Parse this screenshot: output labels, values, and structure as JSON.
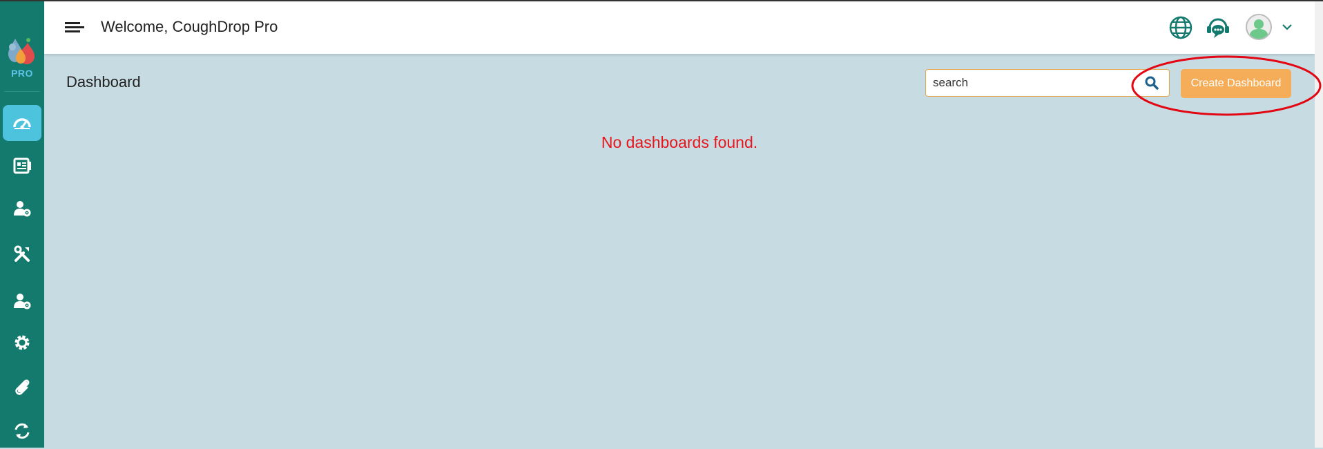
{
  "brand": {
    "badge": "PRO"
  },
  "header": {
    "welcome": "Welcome, CoughDrop Pro"
  },
  "sidebar": {
    "items": [
      {
        "icon": "dashboard-gauge-icon",
        "active": true
      },
      {
        "icon": "boards-icon",
        "active": false
      },
      {
        "icon": "user-settings-icon",
        "active": false
      },
      {
        "icon": "tools-icon",
        "active": false
      },
      {
        "icon": "user-settings-icon",
        "active": false
      },
      {
        "icon": "gear-icon",
        "active": false
      },
      {
        "icon": "paperclip-icon",
        "active": false
      },
      {
        "icon": "sync-icon",
        "active": false
      }
    ]
  },
  "main": {
    "title": "Dashboard",
    "search": {
      "placeholder": "search"
    },
    "create_label": "Create Dashboard",
    "empty_message": "No dashboards found."
  },
  "colors": {
    "sidebar": "#147a6d",
    "active_nav": "#4dc3dd",
    "background": "#c6dbe2",
    "create_button": "#f5ad59",
    "empty_text": "#e8151d",
    "highlight": "#e30613"
  }
}
